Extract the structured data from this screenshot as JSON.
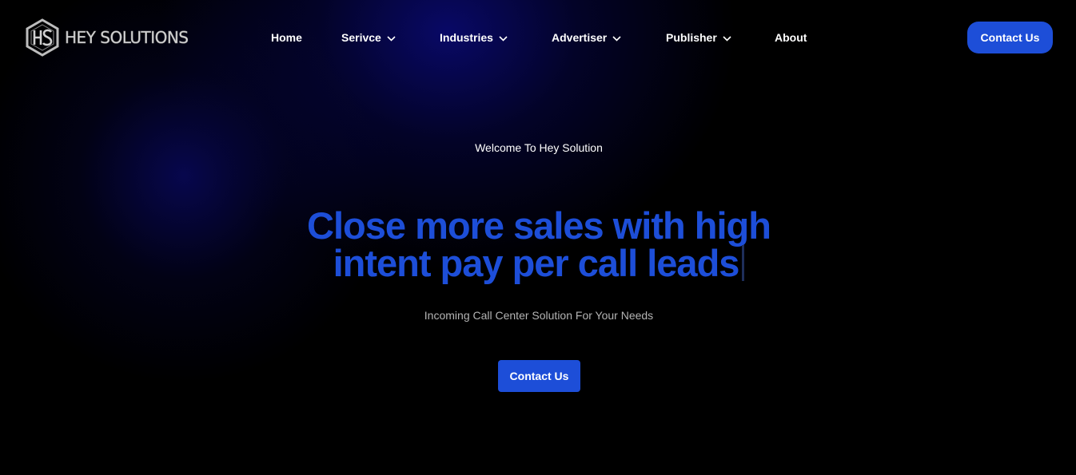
{
  "brand": {
    "logo_icon": "hs-hexagon-logo-icon",
    "name": "HEY SOLUTIONS"
  },
  "nav": [
    {
      "label": "Home",
      "dropdown": false
    },
    {
      "label": "Serivce",
      "dropdown": true
    },
    {
      "label": "Industries",
      "dropdown": true
    },
    {
      "label": "Advertiser",
      "dropdown": true
    },
    {
      "label": "Publisher",
      "dropdown": true
    },
    {
      "label": "About",
      "dropdown": false
    }
  ],
  "header_cta": {
    "label": "Contact Us"
  },
  "hero": {
    "welcome": "Welcome To Hey Solution",
    "headline_line1": "Close more sales with high",
    "headline_line2": "intent pay per call leads",
    "subtitle": "Incoming Call Center Solution For Your Needs",
    "cta_label": "Contact Us"
  },
  "colors": {
    "accent": "#1d4ed8",
    "background": "#000000",
    "glow": "#0a0a78"
  }
}
